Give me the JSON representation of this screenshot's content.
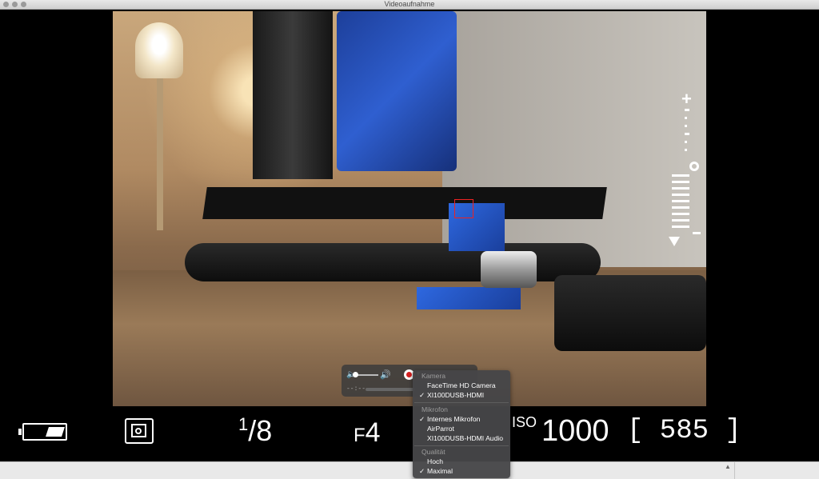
{
  "window": {
    "title": "Videoaufnahme"
  },
  "camera_info": {
    "shutter_numerator": "1",
    "shutter_denominator": "8",
    "aperture_prefix": "F",
    "aperture_value": "4",
    "iso_label": "ISO",
    "iso_value": "1000",
    "shots_remaining": "[ 585 ]"
  },
  "controls": {
    "time_display": "--:--",
    "options_glyph": "▼"
  },
  "menu": {
    "sections": [
      {
        "header": "Kamera",
        "items": [
          {
            "label": "FaceTime HD Camera",
            "checked": false
          },
          {
            "label": "XI100DUSB-HDMI",
            "checked": true
          }
        ]
      },
      {
        "header": "Mikrofon",
        "items": [
          {
            "label": "Internes Mikrofon",
            "checked": true
          },
          {
            "label": "AirParrot",
            "checked": false
          },
          {
            "label": "XI100DUSB-HDMI Audio",
            "checked": false
          }
        ]
      },
      {
        "header": "Qualität",
        "items": [
          {
            "label": "Hoch",
            "checked": false
          },
          {
            "label": "Maximal",
            "checked": true
          }
        ]
      }
    ],
    "check_glyph": "✓"
  }
}
